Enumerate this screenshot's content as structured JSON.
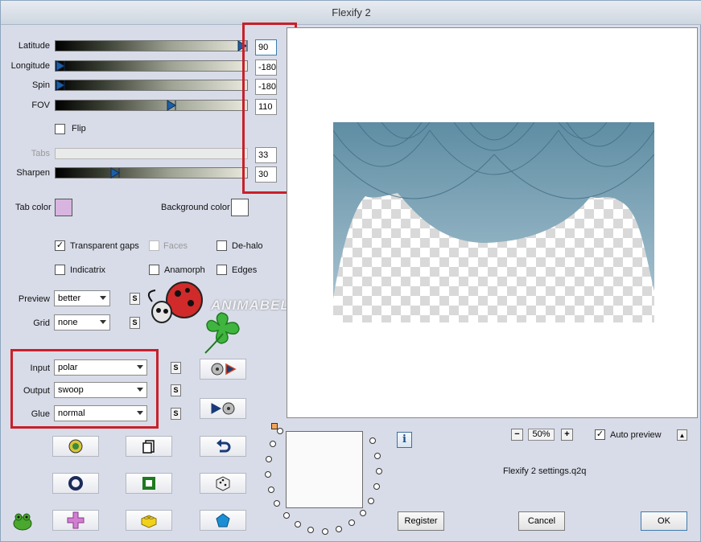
{
  "window": {
    "title": "Flexify 2"
  },
  "sliders": [
    {
      "key": "latitude",
      "label": "Latitude",
      "value": "90",
      "fraction": 1.0,
      "enabled": true
    },
    {
      "key": "longitude",
      "label": "Longitude",
      "value": "-180",
      "fraction": 0.0,
      "enabled": true
    },
    {
      "key": "spin",
      "label": "Spin",
      "value": "-180",
      "fraction": 0.0,
      "enabled": true
    },
    {
      "key": "fov",
      "label": "FOV",
      "value": "110",
      "fraction": 0.61,
      "enabled": true
    },
    {
      "key": "tabs",
      "label": "Tabs",
      "value": "33",
      "fraction": 0.33,
      "enabled": false
    },
    {
      "key": "sharpen",
      "label": "Sharpen",
      "value": "30",
      "fraction": 0.3,
      "enabled": true
    }
  ],
  "flip": {
    "label": "Flip",
    "checked": false
  },
  "colors": {
    "tab_color_label": "Tab color",
    "tab_color": "#d8b4e0",
    "background_color_label": "Background color",
    "background_color": "#ffffff",
    "highlight_red": "#c8202a"
  },
  "options": {
    "transparent_gaps": {
      "label": "Transparent gaps",
      "checked": true
    },
    "faces": {
      "label": "Faces",
      "checked": false
    },
    "dehalo": {
      "label": "De-halo",
      "checked": false
    },
    "indicatrix": {
      "label": "Indicatrix",
      "checked": false
    },
    "anamorph": {
      "label": "Anamorph",
      "checked": false
    },
    "edges": {
      "label": "Edges",
      "checked": false
    }
  },
  "selects": {
    "preview": {
      "label": "Preview",
      "value": "better"
    },
    "grid": {
      "label": "Grid",
      "value": "none"
    },
    "input": {
      "label": "Input",
      "value": "polar"
    },
    "output": {
      "label": "Output",
      "value": "swoop"
    },
    "glue": {
      "label": "Glue",
      "value": "normal"
    }
  },
  "s_label": "S",
  "watermark": "ANIMABELLE",
  "zoom": {
    "value": "50%",
    "minus": "−",
    "plus": "+"
  },
  "auto_preview": {
    "label": "Auto preview",
    "checked": true
  },
  "settings_file": "Flexify 2 settings.q2q",
  "info_label": "i",
  "buttons": {
    "register": "Register",
    "cancel": "Cancel",
    "ok": "OK"
  },
  "tool_icons": [
    "plugin-logo-icon",
    "copy-page-icon",
    "undo-icon",
    "ring-icon",
    "square-frame-icon",
    "dice-icon",
    "cross-shape-icon",
    "lego-brick-icon",
    "pentagon-icon"
  ]
}
